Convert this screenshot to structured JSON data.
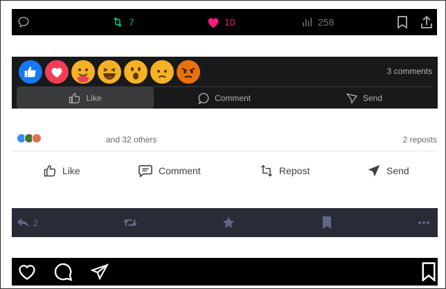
{
  "twitter_bar": {
    "reply_icon": "speech-bubble-icon",
    "retweet_count": "7",
    "like_count": "10",
    "views_count": "258",
    "colors": {
      "retweet": "#00ba7c",
      "like": "#f91880",
      "muted": "#71767b"
    }
  },
  "facebook": {
    "reactions": [
      "like",
      "love",
      "care",
      "haha",
      "wow",
      "sad",
      "angry"
    ],
    "comments_count": "3 comments",
    "actions": {
      "like": "Like",
      "comment": "Comment",
      "send": "Send"
    }
  },
  "linkedin": {
    "others_text": "and 32 others",
    "reposts_text": "2 reposts",
    "actions": {
      "like": "Like",
      "comment": "Comment",
      "repost": "Repost",
      "send": "Send"
    }
  },
  "mastodon_bar": {
    "reply_count": "2"
  },
  "instagram_bar": {
    "icons": [
      "heart-icon",
      "comment-icon",
      "send-icon",
      "bookmark-icon"
    ]
  }
}
